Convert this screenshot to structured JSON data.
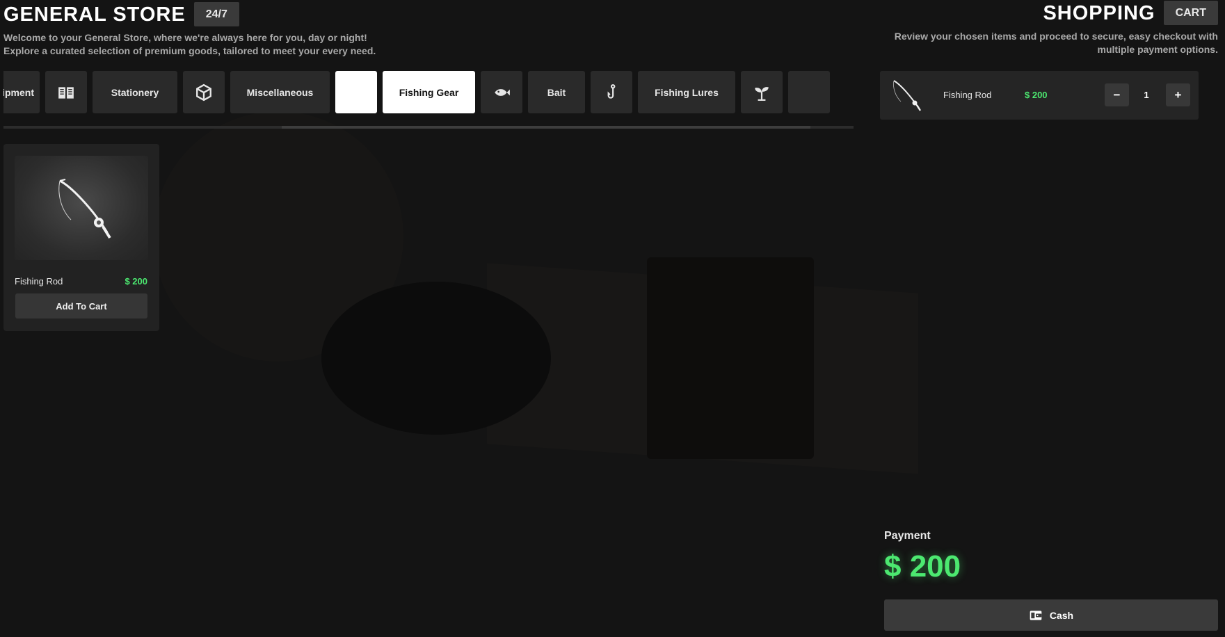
{
  "store": {
    "title": "GENERAL STORE",
    "badge": "24/7",
    "subtitle_line1": "Welcome to your General Store, where we're always here for you, day or night!",
    "subtitle_line2": "Explore a curated selection of premium goods, tailored to meet your every need."
  },
  "shopping": {
    "title": "SHOPPING",
    "badge": "CART",
    "subtitle_line1": "Review your chosen items and proceed to secure, easy checkout with",
    "subtitle_line2": "multiple payment options."
  },
  "categories": [
    {
      "label": "Equipment",
      "icon": "tool-icon"
    },
    {
      "label": "",
      "icon": "book-icon"
    },
    {
      "label": "Stationery",
      "icon": ""
    },
    {
      "label": "",
      "icon": "box-icon"
    },
    {
      "label": "Miscellaneous",
      "icon": ""
    },
    {
      "label": "",
      "icon": "fishing-rod-icon",
      "active": true
    },
    {
      "label": "Fishing Gear",
      "icon": "",
      "active": true
    },
    {
      "label": "",
      "icon": "fish-icon"
    },
    {
      "label": "Bait",
      "icon": ""
    },
    {
      "label": "",
      "icon": "hook-icon"
    },
    {
      "label": "Fishing Lures",
      "icon": ""
    },
    {
      "label": "",
      "icon": "sprout-icon"
    }
  ],
  "products": [
    {
      "name": "Fishing Rod",
      "price": "$ 200",
      "action": "Add To Cart",
      "icon": "fishing-rod-icon"
    }
  ],
  "cart": {
    "items": [
      {
        "name": "Fishing Rod",
        "price": "$ 200",
        "quantity": "1",
        "minus": "−",
        "plus": "+"
      }
    ]
  },
  "payment": {
    "label": "Payment",
    "total": "$ 200",
    "method": "Cash",
    "method_icon": "wallet-icon"
  },
  "colors": {
    "accent_green": "#4ce870",
    "tile_bg": "#2a2a2a",
    "active_tile_bg": "#ffffff"
  }
}
